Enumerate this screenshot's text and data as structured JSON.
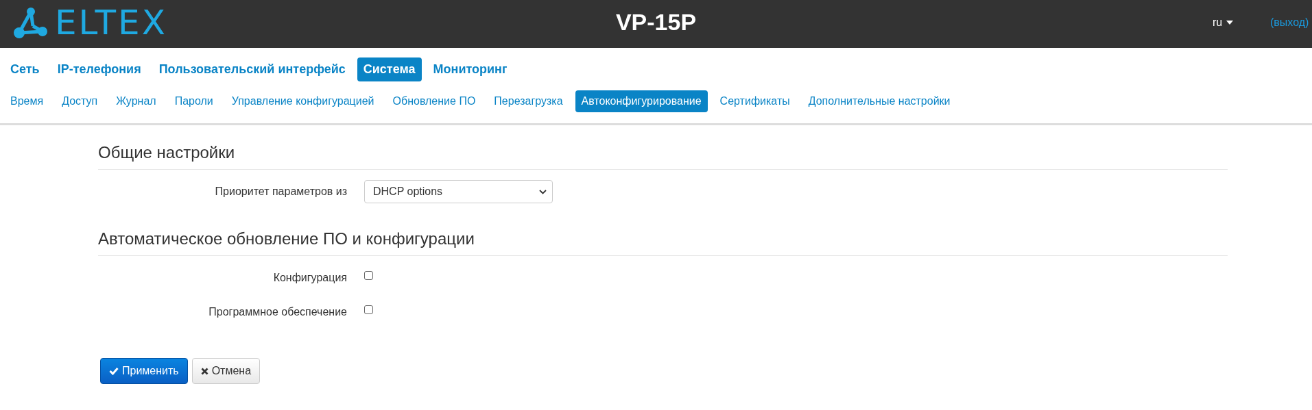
{
  "header": {
    "logo_text": "ELTEX",
    "title": "VP-15P",
    "language": "ru",
    "logout": "(выход)"
  },
  "main_nav": [
    {
      "label": "Сеть",
      "selected": false
    },
    {
      "label": "IP-телефония",
      "selected": false
    },
    {
      "label": "Пользовательский интерфейс",
      "selected": false
    },
    {
      "label": "Система",
      "selected": true
    },
    {
      "label": "Мониторинг",
      "selected": false
    }
  ],
  "sub_nav": [
    {
      "label": "Время",
      "selected": false
    },
    {
      "label": "Доступ",
      "selected": false
    },
    {
      "label": "Журнал",
      "selected": false
    },
    {
      "label": "Пароли",
      "selected": false
    },
    {
      "label": "Управление конфигурацией",
      "selected": false
    },
    {
      "label": "Обновление ПО",
      "selected": false
    },
    {
      "label": "Перезагрузка",
      "selected": false
    },
    {
      "label": "Автоконфигурирование",
      "selected": true
    },
    {
      "label": "Сертификаты",
      "selected": false
    },
    {
      "label": "Дополнительные настройки",
      "selected": false
    }
  ],
  "sections": [
    {
      "title": "Общие настройки",
      "fields": [
        {
          "kind": "select",
          "label": "Приоритет параметров из",
          "value": "DHCP options"
        }
      ]
    },
    {
      "title": "Автоматическое обновление ПО и конфигурации",
      "fields": [
        {
          "kind": "checkbox",
          "label": "Конфигурация",
          "checked": false
        },
        {
          "kind": "checkbox",
          "label": "Программное обеспечение",
          "checked": false
        }
      ]
    }
  ],
  "buttons": [
    {
      "kind": "primary",
      "label": "Применить"
    },
    {
      "kind": "default",
      "label": "Отмена"
    }
  ]
}
